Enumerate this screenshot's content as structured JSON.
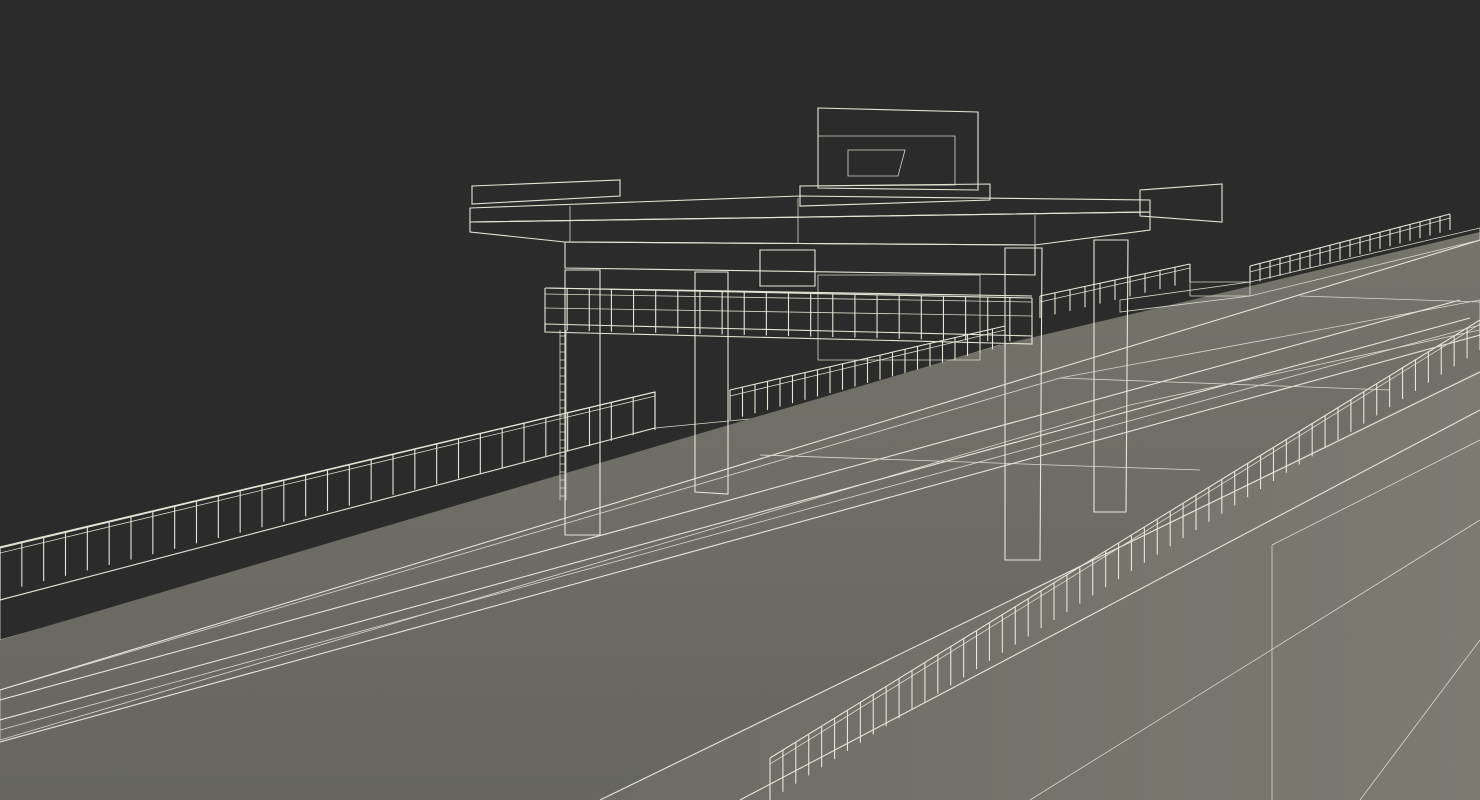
{
  "scene": {
    "subject": "gantry-crane-on-dam-deck",
    "background_color": "#2b2b2b",
    "surface_color": "#6f6f67",
    "surface_shadow": "#5c5c55",
    "wire_color": "#e6e6d8"
  }
}
